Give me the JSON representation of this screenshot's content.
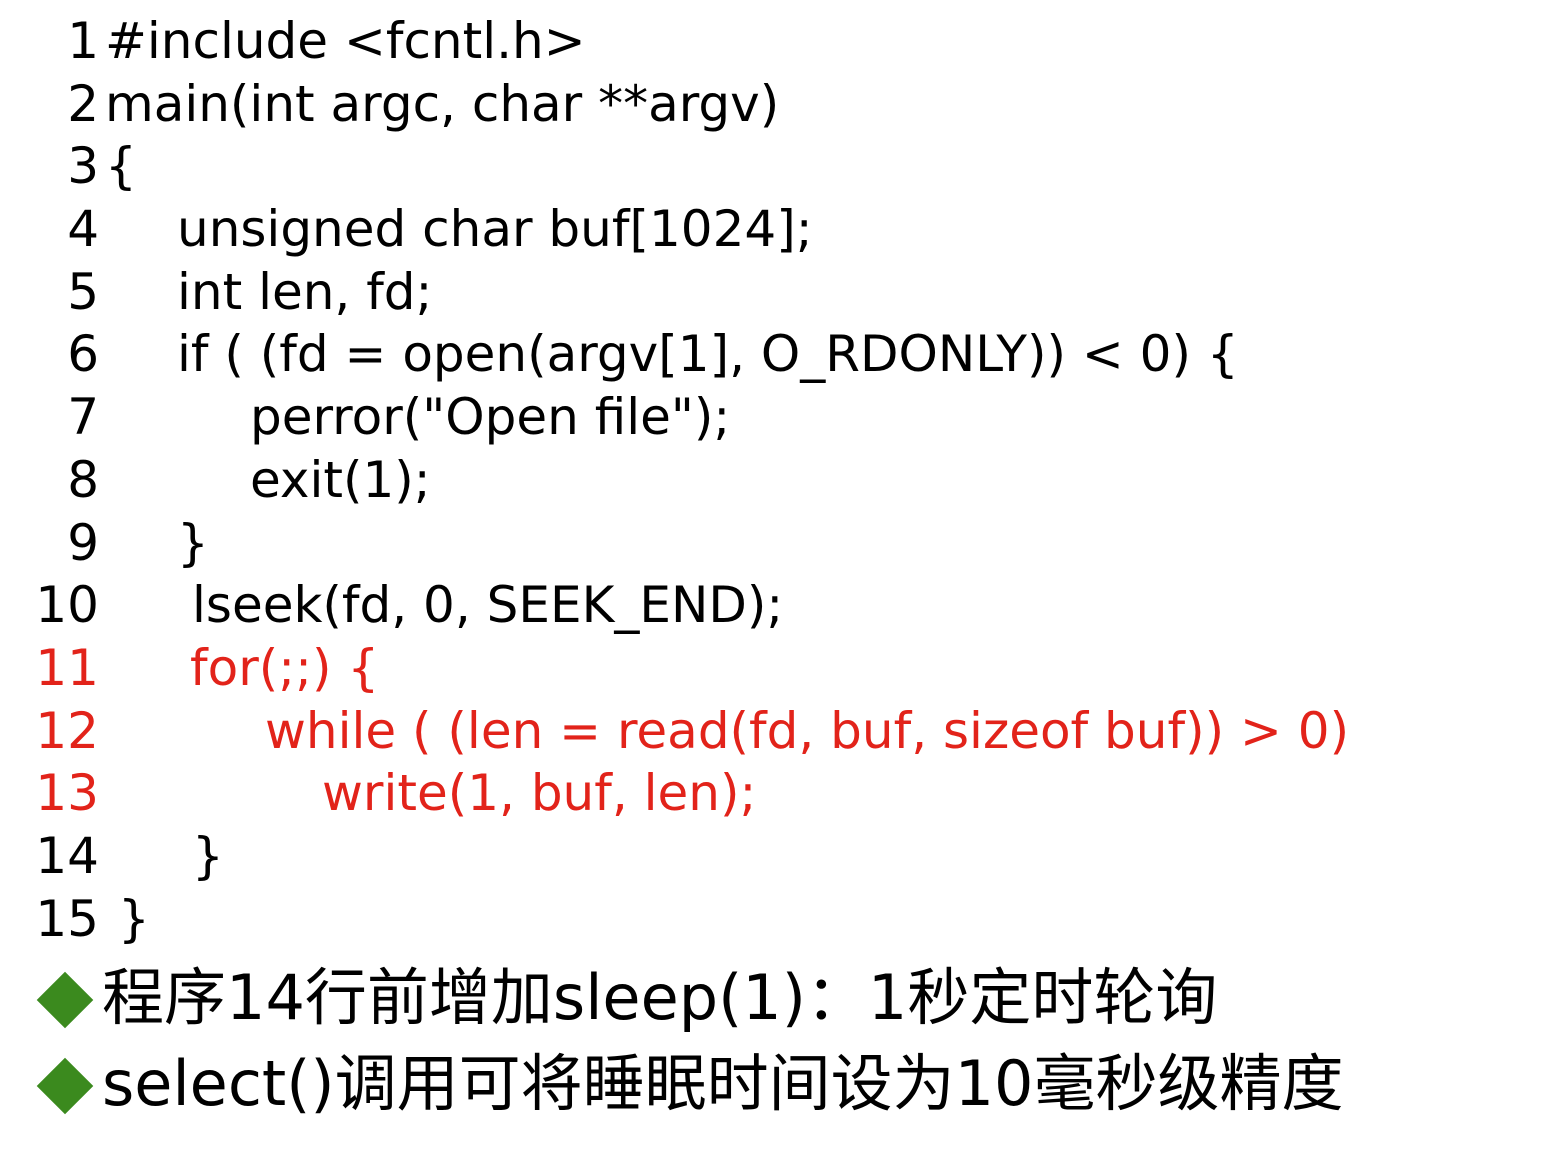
{
  "code": {
    "lines": [
      {
        "num": "1",
        "text": "#include <fcntl.h>"
      },
      {
        "num": "2",
        "text": "main(int argc, char **argv)"
      },
      {
        "num": "3",
        "text": "{"
      },
      {
        "num": "4",
        "text": "unsigned char buf[1024];"
      },
      {
        "num": "5",
        "text": "int len, fd;"
      },
      {
        "num": "6",
        "text": "if ( (fd = open(argv[1], O_RDONLY)) < 0) {"
      },
      {
        "num": "7",
        "text": "perror(\"Open file\");"
      },
      {
        "num": "8",
        "text": "exit(1);"
      },
      {
        "num": "9",
        "text": "}"
      },
      {
        "num": "10",
        "text": "lseek(fd, 0, SEEK_END);"
      },
      {
        "num": "11",
        "text": "for(;;) {"
      },
      {
        "num": "12",
        "text": "while ( (len = read(fd, buf, sizeof buf)) > 0)"
      },
      {
        "num": "13",
        "text": "write(1, buf, len);"
      },
      {
        "num": "14",
        "text": "}"
      },
      {
        "num": "15",
        "text": "}"
      }
    ]
  },
  "bullets": [
    {
      "text": "程序14行前增加sleep(1)：1秒定时轮询"
    },
    {
      "text": "select()调用可将睡眠时间设为10毫秒级精度"
    }
  ],
  "colors": {
    "text": "#000000",
    "highlight": "#e2231a",
    "bullet": "#3b8a1e",
    "background": "#ffffff"
  }
}
